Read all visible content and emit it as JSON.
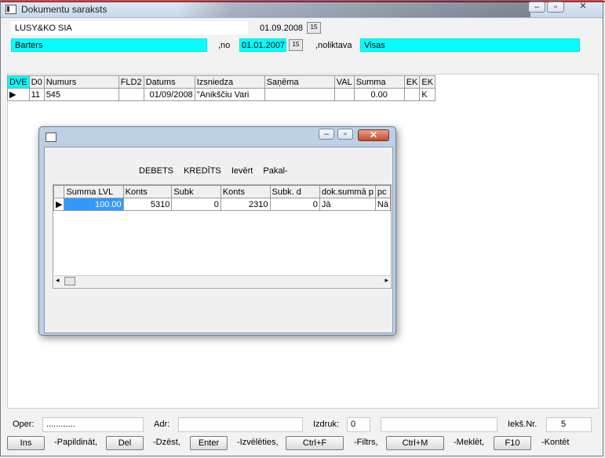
{
  "window": {
    "title": "Dokumentu saraksts"
  },
  "header": {
    "company": "LUSY&KO SIA",
    "date_top": "01.09.2008",
    "doc_type": "Barters",
    "from_label": ",no",
    "from_date": "01.01.2007",
    "warehouse_label": ",noliktava",
    "warehouse_value": "Visas"
  },
  "main_table": {
    "headers": [
      "DVE",
      "D0",
      "Numurs",
      "FLD2",
      "Datums",
      "Izsniedza",
      "Saņēma",
      "VAL",
      "Summa",
      "EK",
      "EK"
    ],
    "rows": [
      [
        "",
        "11",
        "545",
        "",
        "01/09/2008",
        "\"Anikščiu Vari",
        "",
        "",
        "0.00",
        "",
        "K"
      ]
    ]
  },
  "subwindow": {
    "menu": [
      "DEBETS",
      "KREDĪTS",
      "Ievērt",
      "Pakal-"
    ],
    "headers": [
      "Summa LVL",
      "Konts",
      "Subk",
      "Konts",
      "Subk. d",
      "dok.summā p",
      "pc"
    ],
    "rows": [
      [
        "100.00",
        "5310",
        "0",
        "2310",
        "0",
        "Jā",
        "Nā"
      ]
    ]
  },
  "footer": {
    "oper_label": "Oper:",
    "oper_value": "............",
    "adr_label": "Adr:",
    "adr_value": "",
    "izdruk_label": "Izdruk:",
    "izdruk_value": "0",
    "izdruk_extra": "",
    "ieks_label": "Iekš.Nr.",
    "ieks_value": "5"
  },
  "buttons": [
    {
      "key": "Ins",
      "desc": "-Papildināt,"
    },
    {
      "key": "Del",
      "desc": "-Dzēst,"
    },
    {
      "key": "Enter",
      "desc": "-Izvēlēties,"
    },
    {
      "key": "Ctrl+F",
      "desc": "-Filtrs,"
    },
    {
      "key": "Ctrl+M",
      "desc": "-Meklēt,"
    },
    {
      "key": "F10",
      "desc": "-Kontēt"
    }
  ],
  "colors": {
    "highlight": "#00ffff",
    "selected_cell": "#3399ff"
  }
}
